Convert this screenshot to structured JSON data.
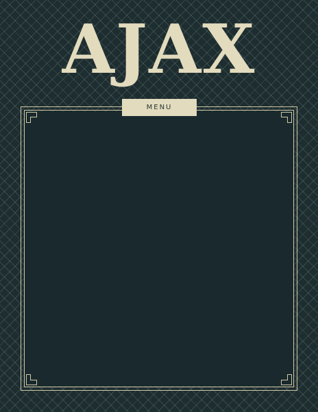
{
  "header": {
    "title": "AJAX"
  },
  "menu_tab": {
    "label": "MENU"
  },
  "colors": {
    "background": "#1e2d2f",
    "panel": "#19292d",
    "accent_cream": "#e2dbbd",
    "frame_line": "#cfc8a8"
  }
}
